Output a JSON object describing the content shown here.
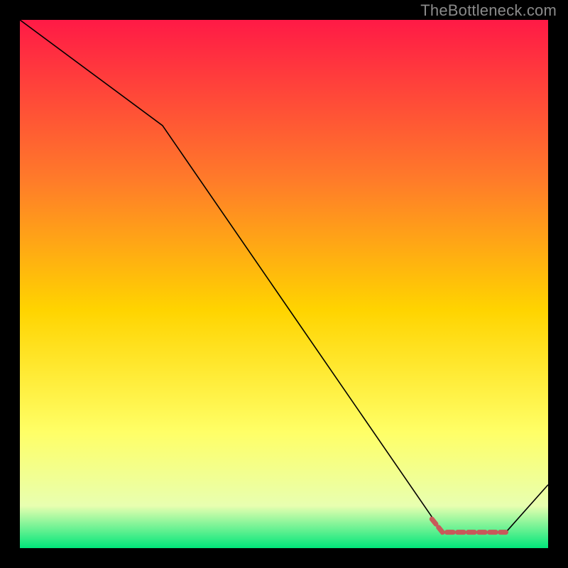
{
  "attribution": "TheBottleneck.com",
  "gradient": {
    "top": "#ff1a46",
    "upper_mid": "#ff7a2a",
    "mid": "#ffd400",
    "lower_mid": "#ffff66",
    "near_bottom": "#e8ffb0",
    "bottom": "#00e67a"
  },
  "chart_data": {
    "type": "line",
    "title": "",
    "xlabel": "",
    "ylabel": "",
    "xlim": [
      0,
      100
    ],
    "ylim": [
      0,
      100
    ],
    "series": [
      {
        "name": "main-curve",
        "stroke": "#000000",
        "stroke_width": 1.6,
        "points": [
          {
            "x": 0,
            "y": 100
          },
          {
            "x": 27,
            "y": 80
          },
          {
            "x": 80,
            "y": 3
          },
          {
            "x": 92,
            "y": 3
          },
          {
            "x": 100,
            "y": 12
          }
        ]
      },
      {
        "name": "highlight-segment",
        "stroke": "#c85a5a",
        "stroke_width": 7,
        "dash": [
          9,
          6
        ],
        "cap": "round",
        "points": [
          {
            "x": 78,
            "y": 5.5
          },
          {
            "x": 80,
            "y": 3
          },
          {
            "x": 92,
            "y": 3
          }
        ]
      }
    ]
  }
}
